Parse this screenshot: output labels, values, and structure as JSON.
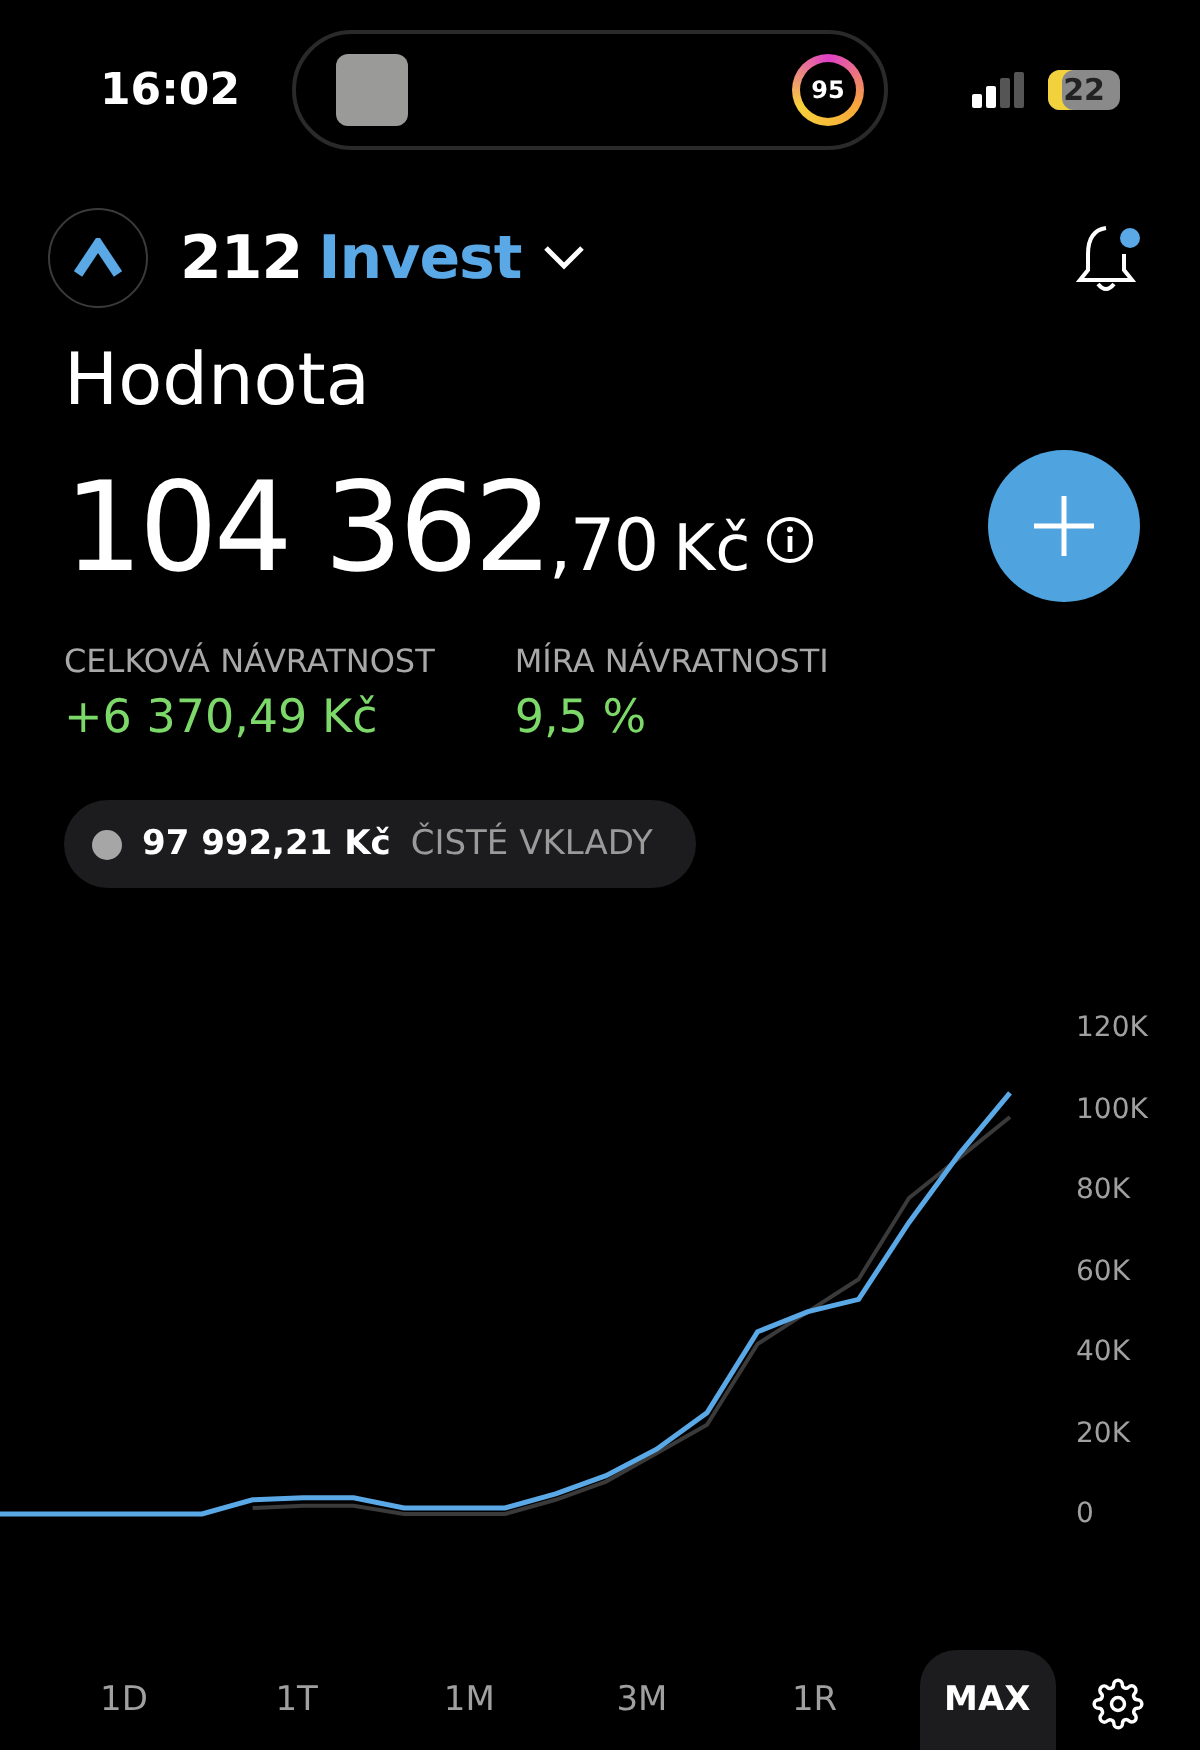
{
  "status_bar": {
    "time": "16:02",
    "activity_ring": "95",
    "battery": "22"
  },
  "header": {
    "brand_number": "212",
    "brand_name": "Invest",
    "notification_dot": true
  },
  "portfolio": {
    "title": "Hodnota",
    "value_main": "104 362",
    "value_decimal": ",70",
    "currency": "Kč"
  },
  "stats": [
    {
      "label": "CELKOVÁ NÁVRATNOST",
      "value": "+6 370,49 Kč"
    },
    {
      "label": "MÍRA NÁVRATNOSTI",
      "value": "9,5 %"
    }
  ],
  "legend": {
    "amount": "97 992,21 Kč",
    "label": "ČISTÉ VKLADY",
    "color": "#a6a6a6"
  },
  "chart": {
    "chart_data": {
      "type": "line",
      "yticks": [
        {
          "value": 0,
          "label": "0"
        },
        {
          "value": 20000,
          "label": "20K"
        },
        {
          "value": 40000,
          "label": "40K"
        },
        {
          "value": 60000,
          "label": "60K"
        },
        {
          "value": 80000,
          "label": "80K"
        },
        {
          "value": 100000,
          "label": "100K"
        },
        {
          "value": 120000,
          "label": "120K"
        }
      ],
      "ylim": [
        0,
        120000
      ],
      "series": [
        {
          "color": "#5aa9e6",
          "values": [
            0,
            0,
            0,
            0,
            0,
            3500,
            4000,
            4000,
            1500,
            1500,
            1500,
            5000,
            9500,
            16000,
            25000,
            45000,
            50000,
            53000,
            72000,
            89000,
            104000
          ]
        },
        {
          "color": "#3a3a3a",
          "values": [
            null,
            null,
            null,
            null,
            null,
            1500,
            2000,
            2000,
            0,
            0,
            0,
            3500,
            8000,
            15000,
            22000,
            42000,
            50000,
            58000,
            78000,
            88000,
            98000
          ]
        }
      ]
    }
  },
  "periods": [
    {
      "label": "1D",
      "selected": false
    },
    {
      "label": "1T",
      "selected": false
    },
    {
      "label": "1M",
      "selected": false
    },
    {
      "label": "3M",
      "selected": false
    },
    {
      "label": "1R",
      "selected": false
    },
    {
      "label": "MAX",
      "selected": true
    }
  ]
}
